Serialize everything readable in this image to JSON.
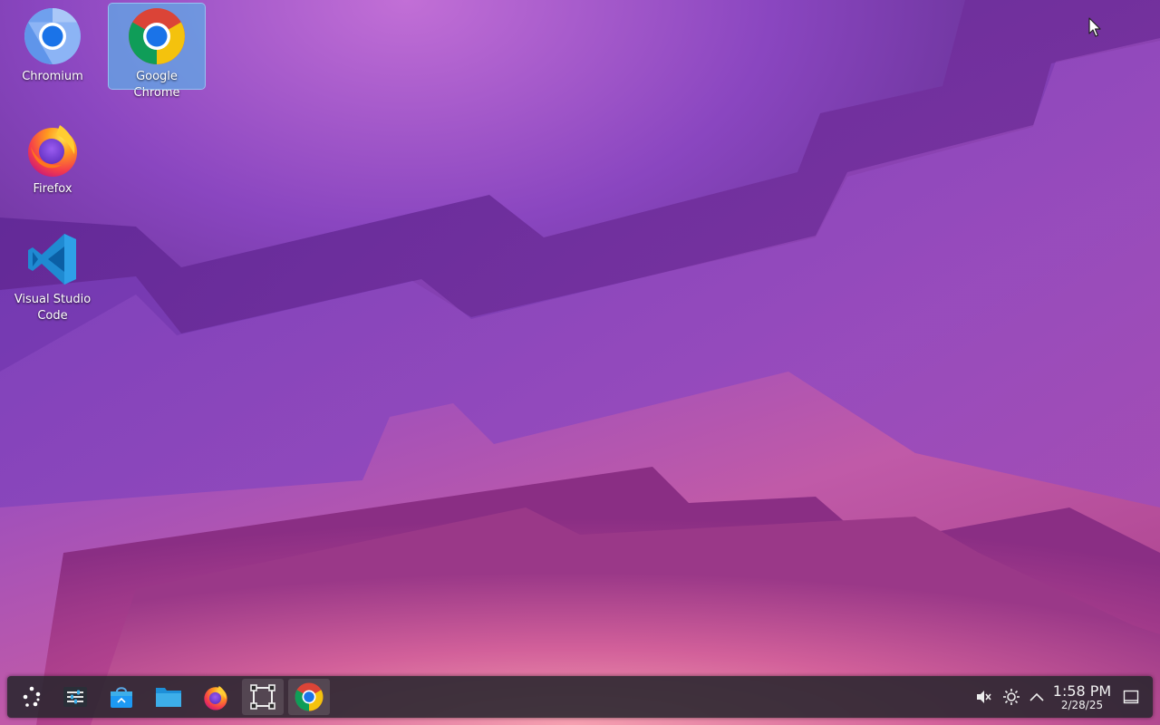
{
  "desktop": {
    "icons": [
      {
        "label": "Chromium",
        "icon": "chromium-icon",
        "selected": false
      },
      {
        "label": "Google Chrome",
        "icon": "google-chrome-icon",
        "selected": true
      },
      {
        "label": "Firefox",
        "icon": "firefox-icon",
        "selected": false
      },
      {
        "label": "Visual Studio Code",
        "icon": "vscode-icon",
        "selected": false
      }
    ]
  },
  "taskbar": {
    "items": [
      {
        "icon": "app-launcher-icon"
      },
      {
        "icon": "system-settings-icon"
      },
      {
        "icon": "discover-store-icon"
      },
      {
        "icon": "file-manager-icon"
      },
      {
        "icon": "firefox-icon"
      },
      {
        "icon": "spectacle-screenshot-icon",
        "active": true
      },
      {
        "icon": "google-chrome-icon",
        "active": true
      }
    ],
    "tray": [
      {
        "icon": "volume-muted-icon"
      },
      {
        "icon": "brightness-icon"
      },
      {
        "icon": "chevron-up-icon"
      }
    ],
    "clock": {
      "time": "1:58 PM",
      "date": "2/28/25"
    },
    "show_desktop_icon": "show-desktop-icon"
  },
  "colors": {
    "wallpaper_top": "#4a1f7a",
    "wallpaper_mid": "#8a3fb0",
    "wallpaper_bottom": "#d0508a",
    "selection": "#5faae6",
    "panel": "#28262e"
  }
}
